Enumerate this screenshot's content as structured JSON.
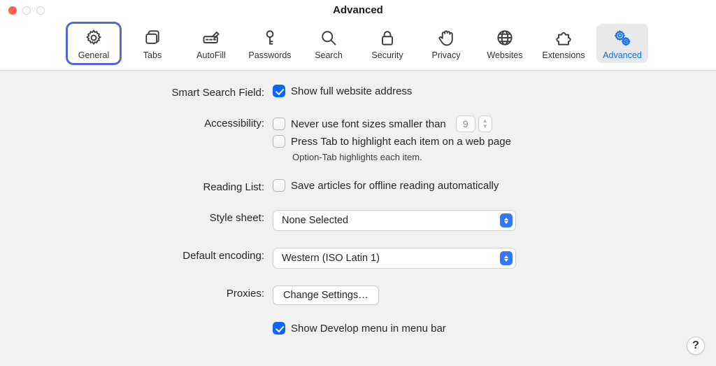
{
  "title": "Advanced",
  "tabs": [
    {
      "id": "general",
      "label": "General"
    },
    {
      "id": "tabs",
      "label": "Tabs"
    },
    {
      "id": "autofill",
      "label": "AutoFill"
    },
    {
      "id": "passwords",
      "label": "Passwords"
    },
    {
      "id": "search",
      "label": "Search"
    },
    {
      "id": "security",
      "label": "Security"
    },
    {
      "id": "privacy",
      "label": "Privacy"
    },
    {
      "id": "websites",
      "label": "Websites"
    },
    {
      "id": "extensions",
      "label": "Extensions"
    },
    {
      "id": "advanced",
      "label": "Advanced"
    }
  ],
  "form": {
    "smart_search": {
      "label": "Smart Search Field:",
      "option": "Show full website address",
      "checked": true
    },
    "accessibility": {
      "label": "Accessibility:",
      "font_option": "Never use font sizes smaller than",
      "font_checked": false,
      "font_value": "9",
      "tab_option": "Press Tab to highlight each item on a web page",
      "tab_checked": false,
      "tab_hint": "Option-Tab highlights each item."
    },
    "reading_list": {
      "label": "Reading List:",
      "option": "Save articles for offline reading automatically",
      "checked": false
    },
    "style_sheet": {
      "label": "Style sheet:",
      "value": "None Selected"
    },
    "default_encoding": {
      "label": "Default encoding:",
      "value": "Western (ISO Latin 1)"
    },
    "proxies": {
      "label": "Proxies:",
      "button": "Change Settings…"
    },
    "develop": {
      "option": "Show Develop menu in menu bar",
      "checked": true
    }
  },
  "help_label": "?"
}
